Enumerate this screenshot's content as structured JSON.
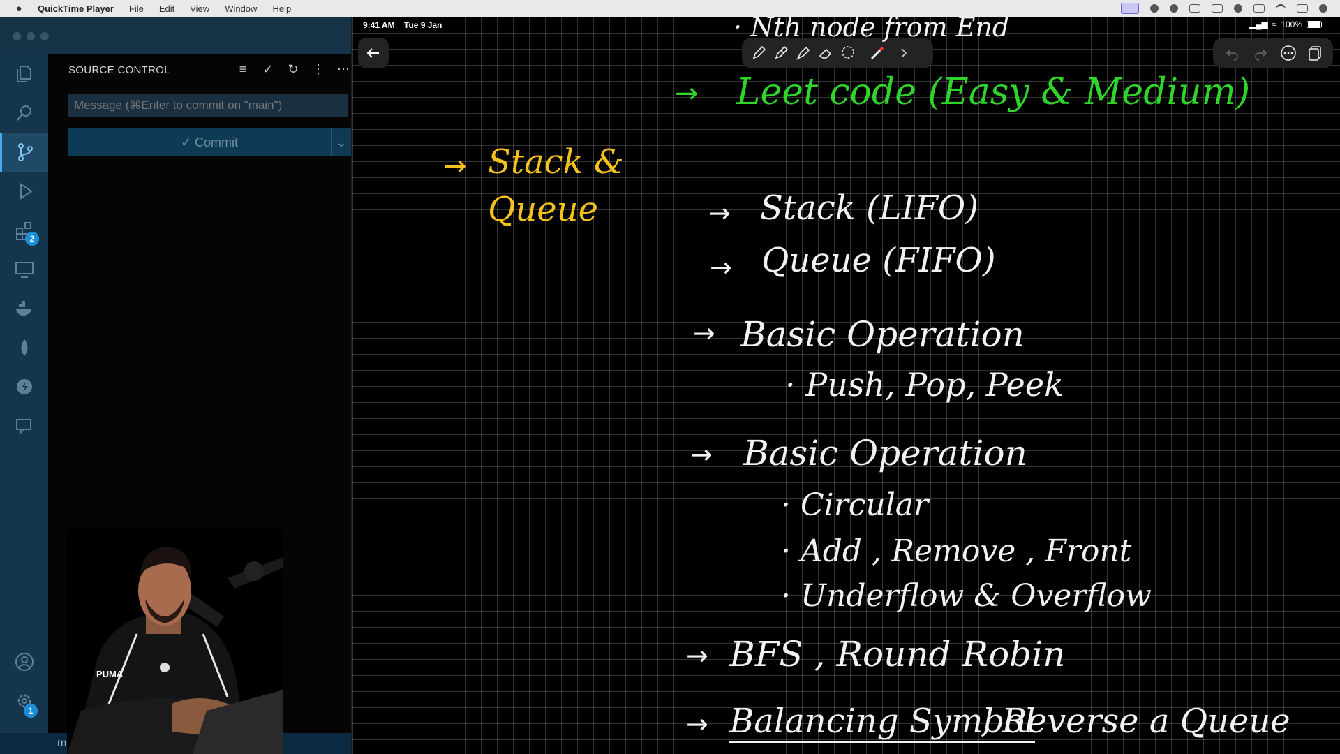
{
  "menubar": {
    "app_name": "QuickTime Player",
    "items": [
      "File",
      "Edit",
      "View",
      "Window",
      "Help"
    ]
  },
  "vscode": {
    "sidebar_title": "SOURCE CONTROL",
    "commit_message_placeholder": "Message (⌘Enter to commit on \"main\")",
    "commit_button_label": "✓ Commit",
    "extensions_badge": "2",
    "settings_badge": "1",
    "status_branch": "ma"
  },
  "ipad": {
    "time": "9:41 AM",
    "date": "Tue 9 Jan",
    "battery": "100%"
  },
  "notes": {
    "top_partial": "· Nth node from End",
    "leetcode": "Leet code (Easy & Medium)",
    "topic_line1": "Stack &",
    "topic_line2": "Queue",
    "stack": "Stack (LIFO)",
    "queue": "Queue (FIFO)",
    "basic_op_1": "Basic Operation",
    "push_pop_peek": "· Push, Pop, Peek",
    "basic_op_2": "Basic Operation",
    "circular": "· Circular",
    "add_remove_front": "· Add , Remove , Front",
    "under_over_flow": "· Underflow & Overflow",
    "bfs_round_robin": "BFS , Round Robin",
    "balancing_symbol": "Balancing Symbol",
    "reverse_queue": ", Reverse a Queue",
    "arrow": "→"
  },
  "colors": {
    "green_ink": "#2fd52b",
    "yellow_ink": "#f4c21a",
    "white_ink": "#f2f2f2",
    "vscode_accent": "#1a8fd8"
  }
}
